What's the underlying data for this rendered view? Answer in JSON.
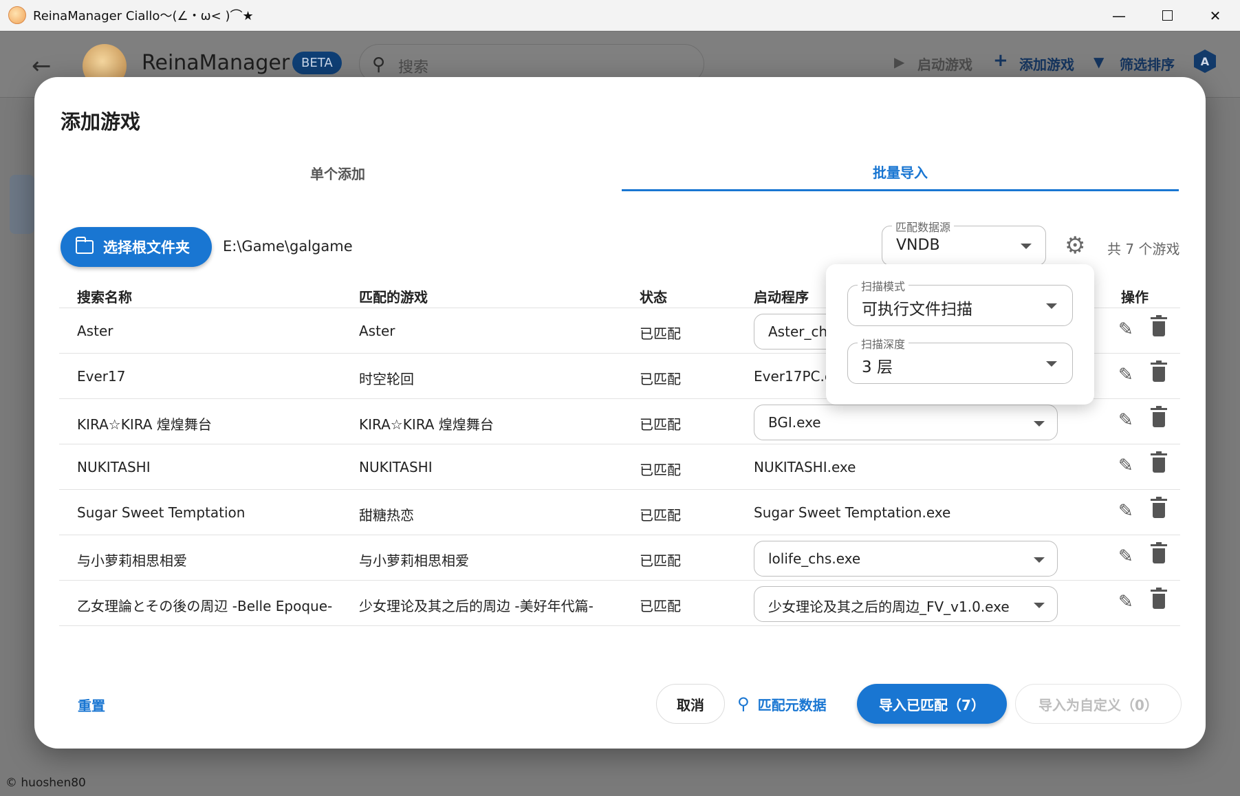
{
  "window": {
    "title": "ReinaManager Ciallo～(∠・ω< )⌒★",
    "minimize": "—",
    "close": "✕"
  },
  "appbar": {
    "brand": "ReinaManager",
    "badge": "BETA",
    "search_placeholder": "搜索",
    "launch_label": "启动游戏",
    "add_label": "添加游戏",
    "filter_label": "筛选排序",
    "lang_icon": "A"
  },
  "credit": "© huoshen80",
  "dialog": {
    "title": "添加游戏",
    "tabs": [
      "单个添加",
      "批量导入"
    ],
    "pick_folder_label": "选择根文件夹",
    "root_path": "E:\\Game\\galgame",
    "source": {
      "label": "匹配数据源",
      "value": "VNDB"
    },
    "count_text": "共 7 个游戏",
    "columns": [
      "搜索名称",
      "匹配的游戏",
      "状态",
      "启动程序",
      "操作"
    ],
    "rows": [
      {
        "search_name": "Aster",
        "matched": "Aster",
        "status": "已匹配",
        "exe": "Aster_chs.exe",
        "exe_select": true
      },
      {
        "search_name": "Ever17",
        "matched": "时空轮回",
        "status": "已匹配",
        "exe": "Ever17PC.exe",
        "exe_select": false
      },
      {
        "search_name": "KIRA☆KIRA 煌煌舞台",
        "matched": "KIRA☆KIRA 煌煌舞台",
        "status": "已匹配",
        "exe": "BGI.exe",
        "exe_select": true
      },
      {
        "search_name": "NUKITASHI",
        "matched": "NUKITASHI",
        "status": "已匹配",
        "exe": "NUKITASHI.exe",
        "exe_select": false
      },
      {
        "search_name": "Sugar Sweet Temptation",
        "matched": "甜糖热恋",
        "status": "已匹配",
        "exe": "Sugar Sweet Temptation.exe",
        "exe_select": false
      },
      {
        "search_name": "与小萝莉相思相爱",
        "matched": "与小萝莉相思相爱",
        "status": "已匹配",
        "exe": "lolife_chs.exe",
        "exe_select": true
      },
      {
        "search_name": "乙女理論とその後の周辺 -Belle Epoque-",
        "matched": "少女理论及其之后的周边 -美好年代篇-",
        "status": "已匹配",
        "exe": "少女理论及其之后的周边_FV_v1.0.exe",
        "exe_select": true
      }
    ],
    "scan_popover": {
      "mode_label": "扫描模式",
      "mode_value": "可执行文件扫描",
      "depth_label": "扫描深度",
      "depth_value": "3 层"
    },
    "footer": {
      "reset": "重置",
      "cancel": "取消",
      "match_meta": "匹配元数据",
      "import_matched": "导入已匹配（7）",
      "import_custom": "导入为自定义（0）"
    }
  },
  "icons": {
    "back": "←",
    "search": "⚲",
    "play": "▶",
    "plus": "+",
    "filter": "▼",
    "gear": "⚙",
    "edit": "✎"
  }
}
